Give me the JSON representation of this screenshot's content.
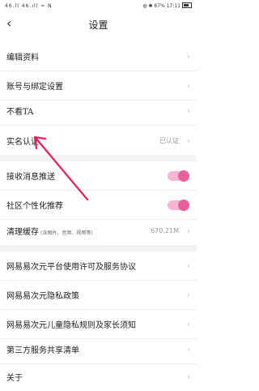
{
  "status_bar": {
    "left": "46.ll 46.ıll ≈ N",
    "right": "◍ ✱ 67% 17:11"
  },
  "header": {
    "back": "‹",
    "title": "设置"
  },
  "rows": {
    "edit_profile": "编辑资料",
    "account_binding": "账号与绑定设置",
    "block_ta": "不看TA",
    "real_name": "实名认证",
    "real_name_status": "已认证",
    "push": "接收消息推送",
    "personalized": "社区个性化推荐",
    "clear_cache": "清理缓存",
    "clear_cache_sub": "(含图片、音频、视频等)",
    "cache_size": "670.21M",
    "service_agreement": "网易易次元平台使用许可及服务协议",
    "privacy": "网易易次元隐私政策",
    "children_privacy": "网易易次元儿童隐私规则及家长须知",
    "third_party": "第三方服务共享清单",
    "about": "关于"
  },
  "toggles": {
    "push_on": true,
    "personalized_on": true
  },
  "chevron": "›",
  "colors": {
    "toggle_knob": "#e8609c",
    "toggle_track": "#f9b5d2",
    "annotation": "#e8205a"
  }
}
